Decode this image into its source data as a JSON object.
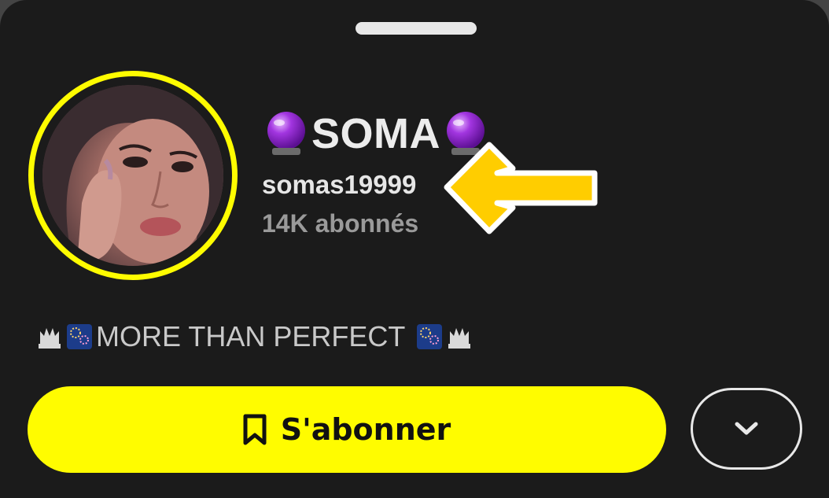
{
  "profile": {
    "display_name": "SOMA",
    "username": "somas19999",
    "subscribers": "14K abonnés",
    "bio": "MORE THAN PERFECT",
    "avatar_icon": "profile-photo",
    "name_decoration_icon": "crystal-ball-icon",
    "bio_decoration_icons": [
      "trident-icon",
      "fireworks-icon"
    ]
  },
  "actions": {
    "subscribe_label": "S'abonner",
    "subscribe_icon": "bookmark-icon",
    "more_icon": "chevron-down-icon"
  },
  "annotation": {
    "arrow_icon": "yellow-arrow-left-icon"
  },
  "colors": {
    "background": "#1b1b1b",
    "accent": "#fffc00",
    "primary_text": "#ececec",
    "secondary_text": "#9a9a9a"
  }
}
